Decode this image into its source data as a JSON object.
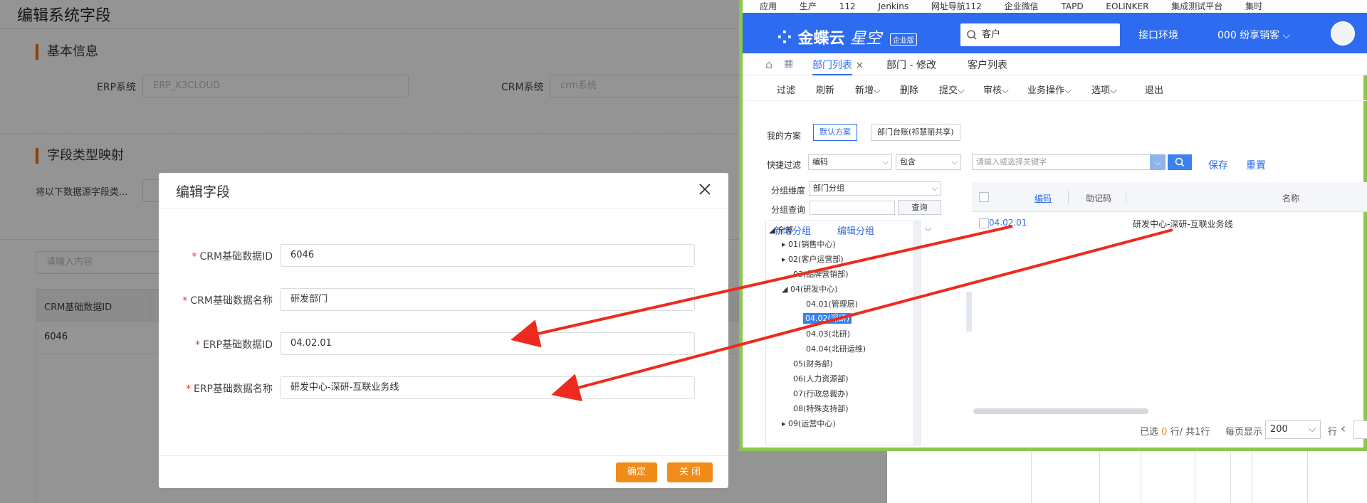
{
  "background": {
    "page_title": "编辑系统字段",
    "section_basic": "基本信息",
    "erp_label": "ERP系统",
    "erp_value": "ERP_K3CLOUD",
    "crm_label": "CRM系统",
    "crm_value": "crm系统",
    "section_mapping": "字段类型映射",
    "mapping_hint": "将以下数据源字段类...",
    "search_placeholder": "请输入内容",
    "table_col1": "CRM基础数据ID",
    "table_row_value": "6046"
  },
  "dialog": {
    "title": "编辑字段",
    "close_icon": "close-icon",
    "fields": [
      {
        "label": "CRM基础数据ID",
        "value": "6046"
      },
      {
        "label": "CRM基础数据名称",
        "value": "研发部门"
      },
      {
        "label": "ERP基础数据ID",
        "value": "04.02.01"
      },
      {
        "label": "ERP基础数据名称",
        "value": "研发中心-深研-互联业务线"
      }
    ],
    "confirm_label": "确定",
    "close_label": "关 闭"
  },
  "kingdee": {
    "bookmarks": [
      "应用",
      "生产",
      "112",
      "Jenkins",
      "网址导航112",
      "企业微信",
      "TAPD",
      "EOLINKER",
      "集成测试平台",
      "集时"
    ],
    "logo": "金蝶云",
    "logo_sub": "星空",
    "edition": "企业版",
    "search_value": "客户",
    "env_label": "接口环境",
    "org_label": "000 纷享销客",
    "tabs": [
      "部门列表",
      "部门 - 修改",
      "客户列表"
    ],
    "toolbar": [
      "过滤",
      "刷新",
      "新增",
      "删除",
      "提交",
      "审核",
      "业务操作",
      "选项",
      "退出"
    ],
    "my_scheme_label": "我的方案",
    "scheme_default": "默认方案",
    "scheme_ledger": "部门台账(祁慧丽共享)",
    "quick_filter_label": "快捷过滤",
    "filter_field": "编码",
    "filter_op": "包含",
    "filter_placeholder": "请输入或选择关键字",
    "save_link": "保存",
    "reset_link": "重置",
    "group_dim_label": "分组维度",
    "group_dim_value": "部门分组",
    "group_query_label": "分组查询",
    "query_button": "查询",
    "add_group": "新增分组",
    "edit_group": "编辑分组",
    "tree": [
      "全部",
      "01(销售中心)",
      "02(客户运营部)",
      "03(品牌营销部)",
      "04(研发中心)",
      "04.01(管理层)",
      "04.02(深研)",
      "04.03(北研)",
      "04.04(北研运维)",
      "05(财务部)",
      "06(人力资源部)",
      "07(行政总裁办)",
      "08(特殊支持部)",
      "09(运营中心)"
    ],
    "grid_headers": [
      "编码",
      "助记码",
      "名称"
    ],
    "grid_row": {
      "code": "04.02.01",
      "name": "研发中心-深研-互联业务线"
    },
    "pager_selected_prefix": "已选",
    "pager_selected_count": "0",
    "pager_selected_suffix": "行/ 共1行",
    "pager_per_page": "每页显示",
    "page_size": "200",
    "pager_row_unit": "行"
  }
}
